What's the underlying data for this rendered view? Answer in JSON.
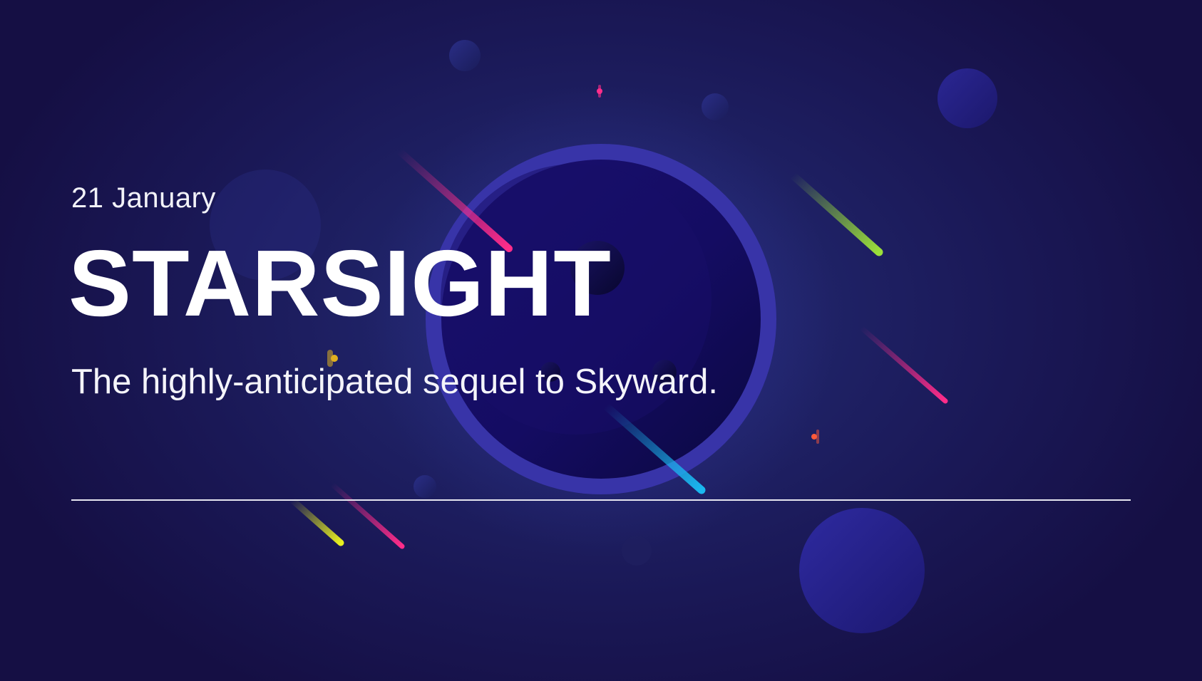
{
  "event": {
    "date": "21 January",
    "title": "STARSIGHT",
    "tagline": "The highly-anticipated sequel to Skyward."
  },
  "colors": {
    "background": "#1a1856",
    "planet_ring": "#3a36b0",
    "planet_core": "#140d5c",
    "text": "#ffffff",
    "streak_pink": "#ff2d8a",
    "streak_green": "#9be03a",
    "streak_cyan": "#1ab8f0",
    "streak_yellow": "#e8f020"
  },
  "decorations": [
    "central-planet",
    "shooting-stars",
    "small-moons",
    "sparkle-stars"
  ]
}
